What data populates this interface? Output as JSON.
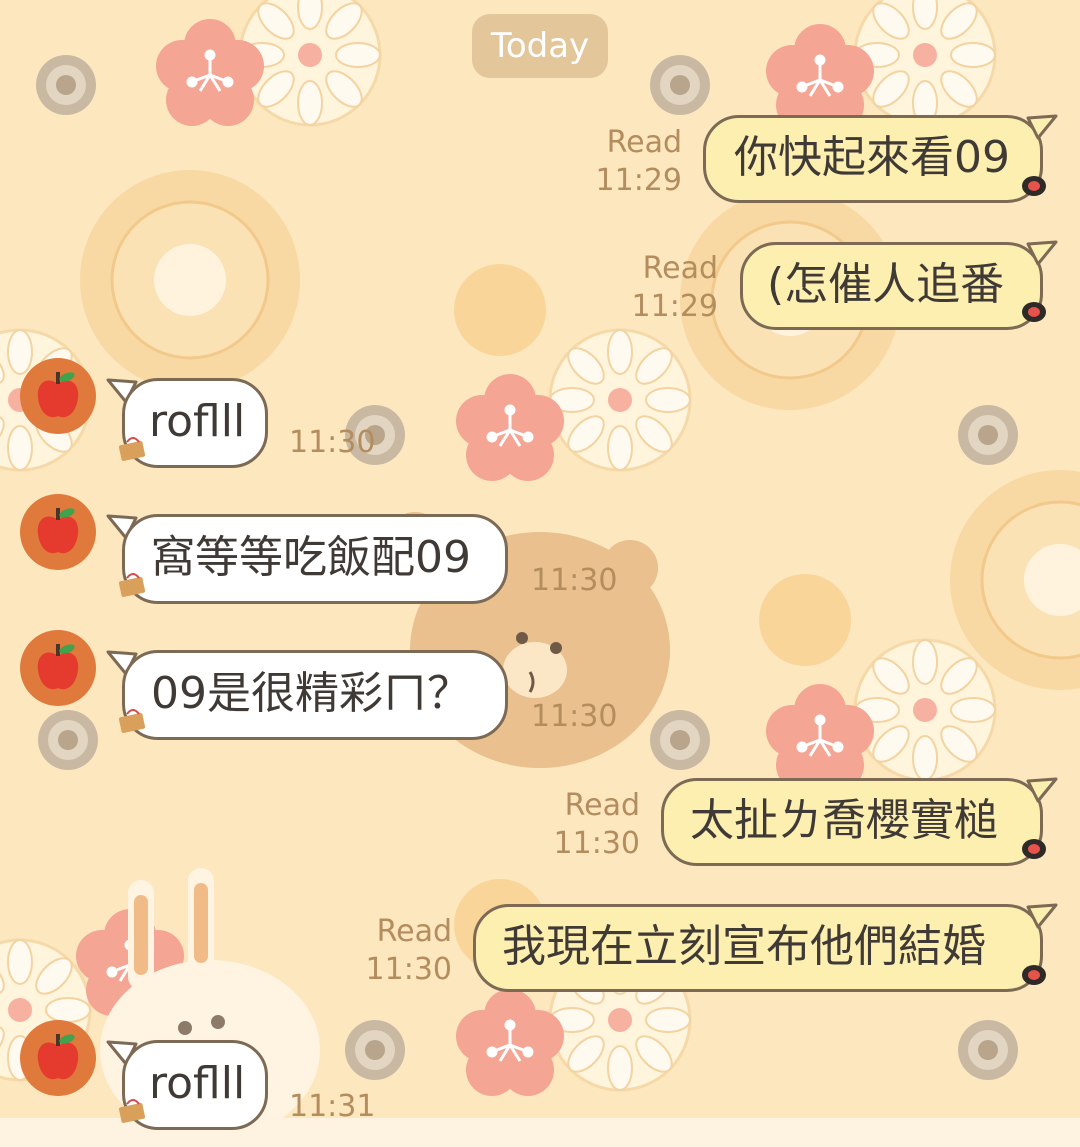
{
  "date_divider": "Today",
  "colors": {
    "background": "#fde7bf",
    "bubble_out": "#fcefb0",
    "bubble_in": "#ffffff",
    "bubble_border": "#7c6a55",
    "meta_text": "#b38d5d",
    "avatar": "#e07a3c"
  },
  "messages": [
    {
      "direction": "outgoing",
      "text": "你快起來看09",
      "status": "Read",
      "time": "11:29"
    },
    {
      "direction": "outgoing",
      "text": "(怎催人追番",
      "status": "Read",
      "time": "11:29"
    },
    {
      "direction": "incoming",
      "text": "roflll",
      "time": "11:30",
      "avatar_icon": "apple-icon"
    },
    {
      "direction": "incoming",
      "text": "窩等等吃飯配09",
      "time": "11:30",
      "avatar_icon": "apple-icon"
    },
    {
      "direction": "incoming",
      "text": "09是很精彩ㄇ？",
      "time": "11:30",
      "avatar_icon": "apple-icon"
    },
    {
      "direction": "outgoing",
      "text": "太扯ㄌ喬櫻實槌",
      "status": "Read",
      "time": "11:30"
    },
    {
      "direction": "outgoing",
      "text": "我現在立刻宣布他們結婚",
      "status": "Read",
      "time": "11:30"
    },
    {
      "direction": "incoming",
      "text": "roflll",
      "time": "11:31",
      "avatar_icon": "apple-icon"
    }
  ]
}
